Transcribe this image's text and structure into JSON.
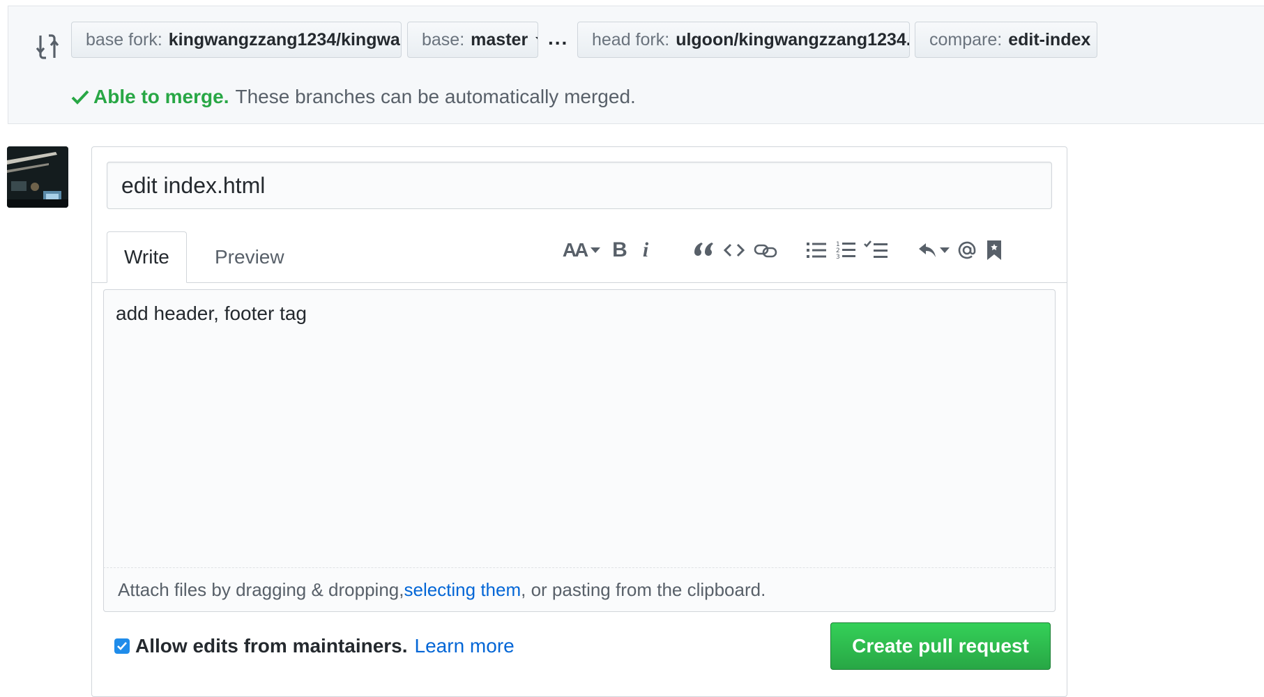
{
  "compare": {
    "base_fork": {
      "label": "base fork:",
      "value": "kingwangzzang1234/kingwa..."
    },
    "base": {
      "label": "base:",
      "value": "master"
    },
    "ellipsis": "...",
    "head_fork": {
      "label": "head fork:",
      "value": "ulgoon/kingwangzzang1234..."
    },
    "compare": {
      "label": "compare:",
      "value": "edit-index"
    },
    "merge_ok": "Able to merge.",
    "merge_msg": "These branches can be automatically merged."
  },
  "form": {
    "title_value": "edit index.html",
    "tabs": [
      {
        "label": "Write",
        "active": true
      },
      {
        "label": "Preview",
        "active": false
      }
    ],
    "toolbar": {
      "header": "AA",
      "bold": "B",
      "italic": "i"
    },
    "body_text": "add header, footer tag",
    "attach": {
      "before": "Attach files by dragging & dropping, ",
      "link": "selecting them",
      "after": ", or pasting from the clipboard."
    },
    "allow_edits": {
      "label": "Allow edits from maintainers.",
      "link": "Learn more",
      "checked": true
    },
    "submit_label": "Create pull request"
  },
  "colors": {
    "success": "#28a745",
    "link": "#0366d6",
    "button_green": "#2cbe4e"
  }
}
